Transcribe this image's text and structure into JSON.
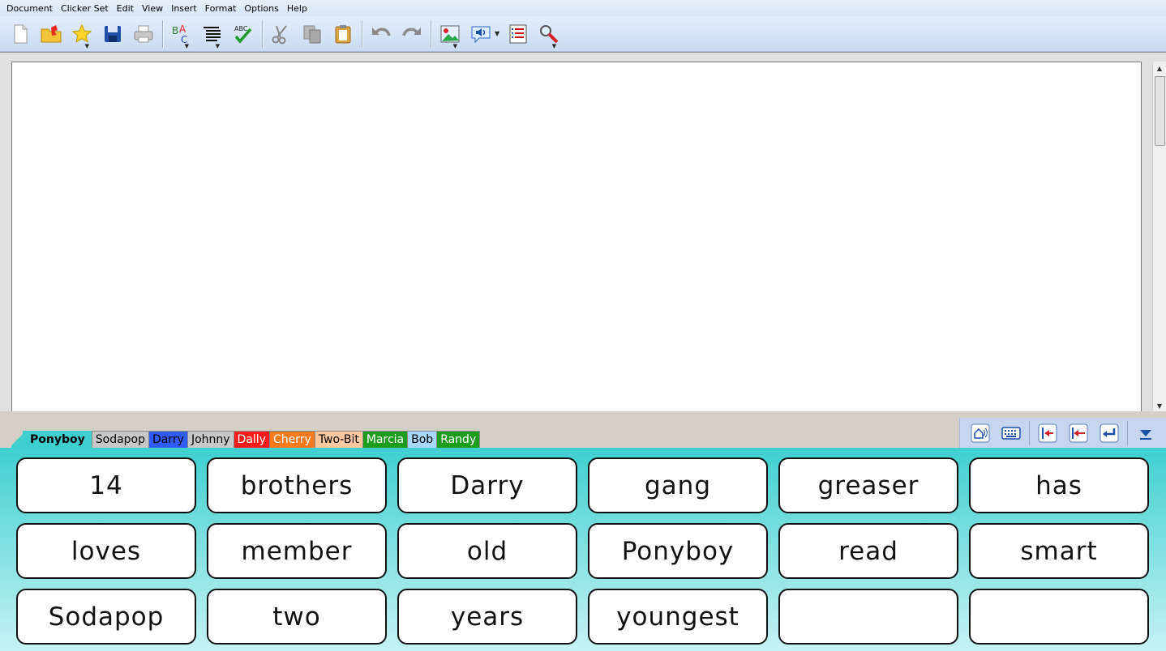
{
  "menu": [
    "Document",
    "Clicker Set",
    "Edit",
    "View",
    "Insert",
    "Format",
    "Options",
    "Help"
  ],
  "toolbar": {
    "icons": [
      "new-document-icon",
      "open-folder-icon",
      "favourites-star-icon",
      "save-disk-icon",
      "print-icon",
      "spell-check-abc-icon",
      "paragraph-format-icon",
      "word-check-icon",
      "cut-scissors-icon",
      "copy-icon",
      "paste-icon",
      "undo-icon",
      "redo-icon",
      "insert-picture-icon",
      "speech-icon",
      "list-icon",
      "find-magnifier-icon"
    ]
  },
  "tabs": [
    {
      "label": "Ponyboy",
      "color": "#40cfcf",
      "active": true
    },
    {
      "label": "Sodapop",
      "color": "#c8c8c8",
      "active": false
    },
    {
      "label": "Darry",
      "color": "#2f5cff",
      "active": false
    },
    {
      "label": "Johnny",
      "color": "#c8c8c8",
      "active": false
    },
    {
      "label": "Dally",
      "color": "#ff1a1a",
      "active": false
    },
    {
      "label": "Cherry",
      "color": "#ff7a1a",
      "active": false
    },
    {
      "label": "Two-Bit",
      "color": "#ffc8a0",
      "active": false
    },
    {
      "label": "Marcia",
      "color": "#1e9c1e",
      "active": false
    },
    {
      "label": "Bob",
      "color": "#a8d8ff",
      "active": false
    },
    {
      "label": "Randy",
      "color": "#1e9c1e",
      "active": false
    }
  ],
  "right_tools": [
    "home-speak-icon",
    "keyboard-icon",
    "go-to-start-icon",
    "backspace-icon",
    "enter-return-icon",
    "hide-grid-icon"
  ],
  "cells": [
    "14",
    "brothers",
    "Darry",
    "gang",
    "greaser",
    "has",
    "loves",
    "member",
    "old",
    "Ponyboy",
    "read",
    "smart",
    "Sodapop",
    "two",
    "years",
    "youngest",
    "",
    ""
  ]
}
